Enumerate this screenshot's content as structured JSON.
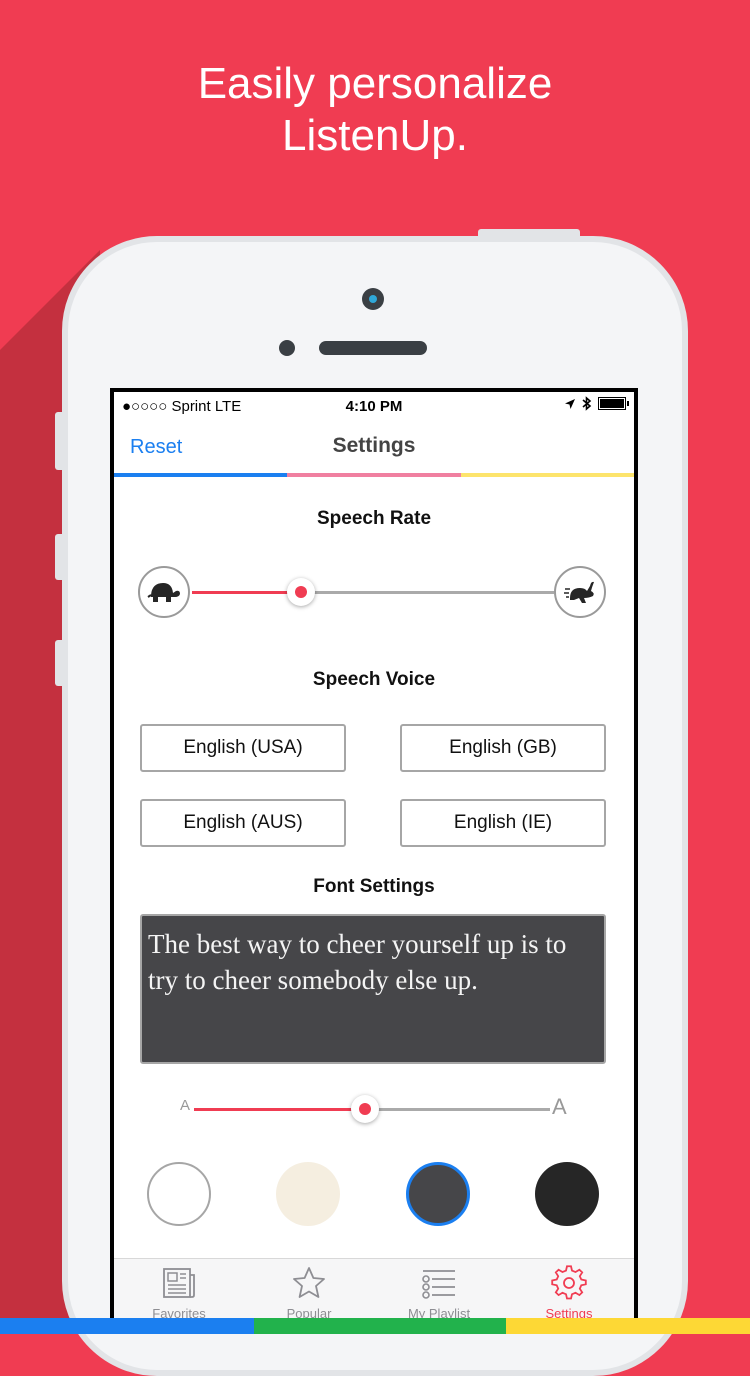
{
  "promo": {
    "headline_line1": "Easily personalize",
    "headline_line2": "ListenUp."
  },
  "status_bar": {
    "carrier": "●○○○○ Sprint  LTE",
    "time": "4:10 PM"
  },
  "nav": {
    "reset_label": "Reset",
    "title": "Settings"
  },
  "speech_rate": {
    "title": "Speech Rate",
    "value_fraction": 0.3,
    "slow_icon": "turtle-icon",
    "fast_icon": "rabbit-icon"
  },
  "speech_voice": {
    "title": "Speech Voice",
    "options": [
      "English (USA)",
      "English (GB)",
      "English (AUS)",
      "English (IE)"
    ]
  },
  "font_settings": {
    "title": "Font Settings",
    "preview_text": "The best way to cheer yourself up is to try to cheer somebody else up.",
    "size_fraction": 0.48,
    "size_min_label": "A",
    "size_max_label": "A",
    "themes": [
      {
        "color": "#ffffff",
        "selected": false
      },
      {
        "color": "#f5eee0",
        "selected": false
      },
      {
        "color": "#464649",
        "selected": true
      },
      {
        "color": "#262626",
        "selected": false
      }
    ]
  },
  "tabs": [
    {
      "label": "Favorites",
      "icon": "newspaper-icon",
      "active": false
    },
    {
      "label": "Popular",
      "icon": "star-icon",
      "active": false
    },
    {
      "label": "My Playlist",
      "icon": "list-icon",
      "active": false
    },
    {
      "label": "Settings",
      "icon": "gear-icon",
      "active": true
    }
  ],
  "colors": {
    "brand_red": "#f03c52",
    "link_blue": "#1b7ff0",
    "stripe_blue": "#1b7ff0",
    "stripe_pink": "#f07fa0",
    "stripe_yellow": "#fde46c",
    "bottom_blue": "#1b7ff0",
    "bottom_green": "#22b24c",
    "bottom_yellow": "#fdd835"
  }
}
